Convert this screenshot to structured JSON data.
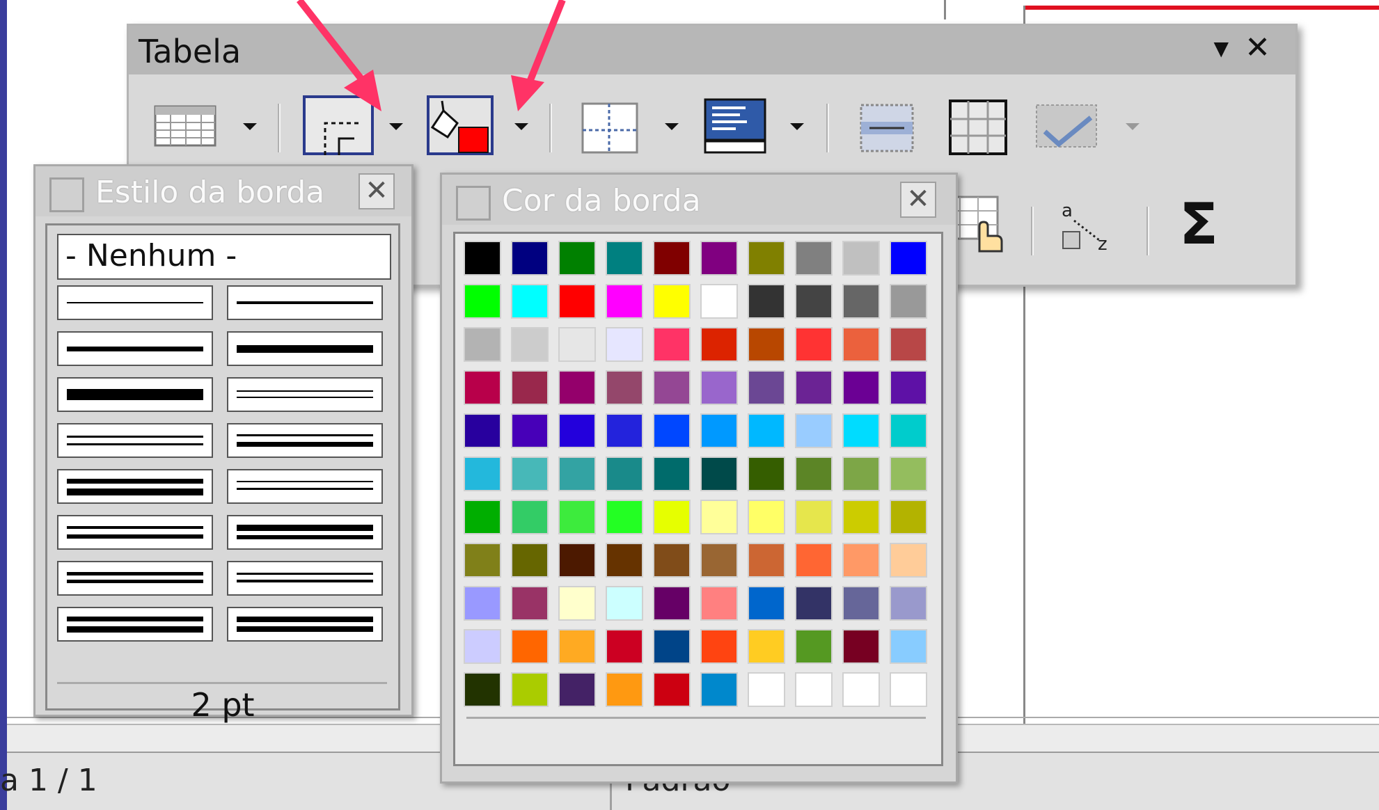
{
  "toolbar": {
    "title": "Tabela",
    "menu_icon": "▼",
    "close_icon": "✕",
    "sum_label": "Σ",
    "sort_label_a": "a",
    "sort_label_z": "z"
  },
  "border_style_panel": {
    "title": "Estilo da borda",
    "none_option": "- Nenhum -",
    "width_label": "2 pt",
    "close_icon": "✕"
  },
  "border_color_panel": {
    "title": "Cor da borda",
    "close_icon": "✕",
    "swatches": [
      [
        "#000000",
        "#000080",
        "#008000",
        "#008080",
        "#800000",
        "#800080",
        "#808000",
        "#808080",
        "#c0c0c0",
        "#0000ff"
      ],
      [
        "#00ff00",
        "#00ffff",
        "#ff0000",
        "#ff00ff",
        "#ffff00",
        "#ffffff",
        "#333333",
        "#444444",
        "#666666",
        "#999999"
      ],
      [
        "#b3b3b3",
        "#cccccc",
        "#e6e6e6",
        "#e6e6ff",
        "#ff3366",
        "#dc2300",
        "#b84700",
        "#ff3333",
        "#eb613d",
        "#b84747"
      ],
      [
        "#b8004a",
        "#99284c",
        "#94006b",
        "#94476b",
        "#944794",
        "#9966cc",
        "#6b4794",
        "#6b2394",
        "#6b0094",
        "#5e11a6"
      ],
      [
        "#28009e",
        "#4700b8",
        "#2300dc",
        "#2323dc",
        "#0047ff",
        "#0099ff",
        "#00b8ff",
        "#99ccff",
        "#00dcff",
        "#00cccc"
      ],
      [
        "#23b8dc",
        "#47b8b8",
        "#33a3a3",
        "#198a8a",
        "#006b6b",
        "#004a4a",
        "#355e00",
        "#5c8526",
        "#7da647",
        "#94bd5e"
      ],
      [
        "#00ae00",
        "#33cc66",
        "#3deb3d",
        "#23ff23",
        "#e6ff00",
        "#ffff99",
        "#ffff66",
        "#e6e64c",
        "#cccc00",
        "#b3b300"
      ],
      [
        "#808019",
        "#666600",
        "#4c1900",
        "#663300",
        "#804c19",
        "#996633",
        "#cc6633",
        "#ff6633",
        "#ff9966",
        "#ffcc99"
      ],
      [
        "#9999ff",
        "#993366",
        "#ffffcc",
        "#ccffff",
        "#660066",
        "#ff8080",
        "#0066cc",
        "#333366",
        "#666699",
        "#9999cc"
      ],
      [
        "#ccccff",
        "#ff6600",
        "#ffaa22",
        "#cc0022",
        "#004488",
        "#ff4411",
        "#ffcc22",
        "#559922",
        "#770022",
        "#88ccff"
      ],
      [
        "#223300",
        "#aacc00",
        "#442266",
        "#ff9911",
        "#cc0011",
        "#0088cc",
        "#ffffff",
        "#ffffff",
        "#ffffff",
        "#ffffff"
      ]
    ]
  },
  "statusbar": {
    "page": "a 1 / 1",
    "style": "Padrão"
  },
  "colors": {
    "annotation_arrow": "#ff3366",
    "background": "#3a3d9c",
    "selected_fill": "#ff0000"
  }
}
